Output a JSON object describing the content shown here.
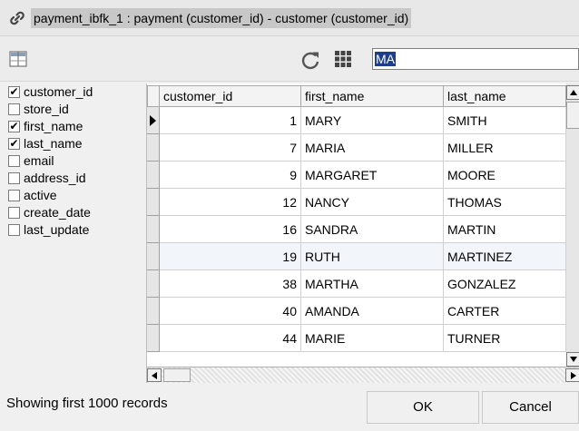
{
  "window": {
    "title": "payment_ibfk_1 : payment (customer_id) - customer (customer_id)",
    "icon": "link-icon"
  },
  "toolbar": {
    "columns_toggle_icon": "columns-icon",
    "refresh_icon": "refresh-icon",
    "grid_icon": "grid-icon",
    "filter_value": "MA"
  },
  "columns": [
    {
      "name": "customer_id",
      "checked": true
    },
    {
      "name": "store_id",
      "checked": false
    },
    {
      "name": "first_name",
      "checked": true
    },
    {
      "name": "last_name",
      "checked": true
    },
    {
      "name": "email",
      "checked": false
    },
    {
      "name": "address_id",
      "checked": false
    },
    {
      "name": "active",
      "checked": false
    },
    {
      "name": "create_date",
      "checked": false
    },
    {
      "name": "last_update",
      "checked": false
    }
  ],
  "table": {
    "headers": [
      "customer_id",
      "first_name",
      "last_name"
    ],
    "rows": [
      [
        "1",
        "MARY",
        "SMITH"
      ],
      [
        "7",
        "MARIA",
        "MILLER"
      ],
      [
        "9",
        "MARGARET",
        "MOORE"
      ],
      [
        "12",
        "NANCY",
        "THOMAS"
      ],
      [
        "16",
        "SANDRA",
        "MARTIN"
      ],
      [
        "19",
        "RUTH",
        "MARTINEZ"
      ],
      [
        "38",
        "MARTHA",
        "GONZALEZ"
      ],
      [
        "40",
        "AMANDA",
        "CARTER"
      ],
      [
        "44",
        "MARIE",
        "TURNER"
      ]
    ],
    "current_row": 0,
    "highlighted_row": 5
  },
  "footer": {
    "status": "Showing first 1000 records",
    "ok_label": "OK",
    "cancel_label": "Cancel"
  },
  "colors": {
    "selection": "#1e3f88",
    "row_highlight": "#f2f6fb"
  }
}
